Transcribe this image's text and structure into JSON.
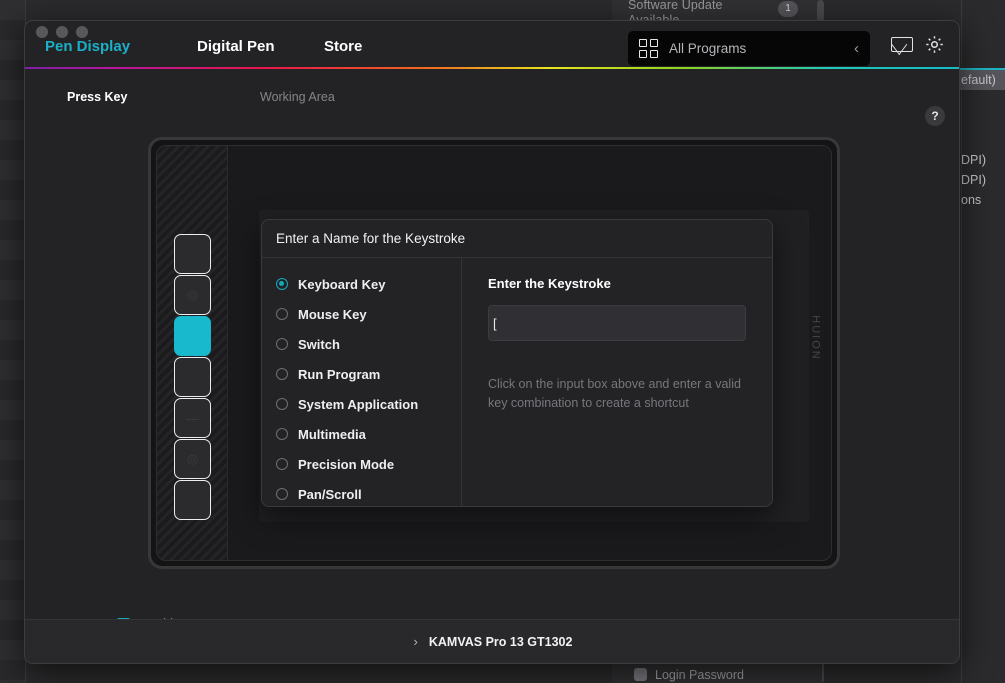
{
  "backdrop": {
    "top_note": "Software Update\nAvailable",
    "top_note_line1": "Software Update",
    "top_note_line2": "Available",
    "badge_count": "1",
    "right_rows": [
      "efault)",
      "",
      "",
      "",
      "DPI)",
      "DPI)",
      "ons"
    ],
    "bottom_label": "Login Password"
  },
  "window": {
    "nav_tabs": [
      {
        "label": "Pen Display",
        "active": true
      },
      {
        "label": "Digital Pen",
        "active": false
      },
      {
        "label": "Store",
        "active": false
      }
    ],
    "search": {
      "label": "All Programs",
      "collapse_glyph": "‹",
      "grid_icon": "grid-icon"
    },
    "icons": {
      "mail": "mail-icon",
      "gear": "gear-icon",
      "help": "?"
    },
    "sub_tabs": [
      {
        "label": "Press Key",
        "active": true
      },
      {
        "label": "Working Area",
        "active": false
      }
    ],
    "accent_color": "#1ab0c8",
    "rainbow_divider": true
  },
  "tablet": {
    "brand": "HUION",
    "keys": [
      {
        "id": "key-1",
        "symbol": "",
        "active": false
      },
      {
        "id": "key-2",
        "symbol": "◎",
        "active": false
      },
      {
        "id": "key-3",
        "symbol": "",
        "active": true
      },
      {
        "id": "key-4",
        "symbol": "",
        "active": false
      },
      {
        "id": "key-5",
        "symbol": "—",
        "active": false
      },
      {
        "id": "key-6",
        "symbol": "◎",
        "active": false
      },
      {
        "id": "key-7",
        "symbol": "",
        "active": false
      },
      {
        "id": "key-8",
        "symbol": "",
        "active": false
      }
    ],
    "active_key_color": "#18b9cd"
  },
  "modal": {
    "title": "Enter a Name for the Keystroke",
    "options": [
      {
        "label": "Keyboard Key",
        "selected": true
      },
      {
        "label": "Mouse Key",
        "selected": false
      },
      {
        "label": "Switch",
        "selected": false
      },
      {
        "label": "Run Program",
        "selected": false
      },
      {
        "label": "System Application",
        "selected": false
      },
      {
        "label": "Multimedia",
        "selected": false
      },
      {
        "label": "Precision Mode",
        "selected": false
      },
      {
        "label": "Pan/Scroll",
        "selected": false
      }
    ],
    "field_title": "Enter the Keystroke",
    "input_value": "[",
    "input_placeholder": "",
    "hint": "Click on the input box above and  enter a valid key combination to create a shortcut"
  },
  "footer": {
    "enable_label": "Enable Press Keys",
    "enable_checked": true,
    "device_chevron": "›",
    "device_name": "KAMVAS Pro 13 GT1302"
  }
}
